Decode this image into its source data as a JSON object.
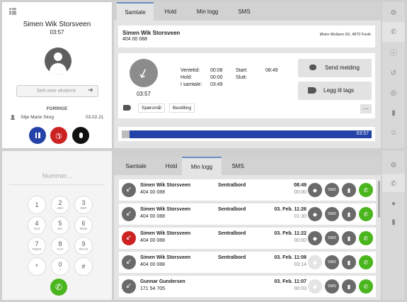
{
  "top": {
    "left": {
      "caller_name": "Simen Wik Storsveen",
      "duration": "03:57",
      "transfer_placeholder": "Sett over eksternt",
      "previous_label": "FORRIGE",
      "previous_contact": "Silje Marie Skog",
      "previous_date": "03.02.21"
    },
    "tabs": [
      "Samtale",
      "Hold",
      "Min logg",
      "SMS"
    ],
    "contact": {
      "name": "Simen Wik Storsveen",
      "phone": "404 00 088",
      "address": "Østre Moåsen 60, 4870 Fevik"
    },
    "call": {
      "duration": "03:57",
      "waiting_label": "Ventetid:",
      "waiting_value": "00:08",
      "hold_label": "Hold:",
      "hold_value": "00:00",
      "in_call_label": "I samtale:",
      "in_call_value": "03:49",
      "start_label": "Start:",
      "start_value": "08:49",
      "end_label": "Slutt:",
      "end_value": ""
    },
    "actions": {
      "send_message": "Send melding",
      "add_tags": "Legg til tags",
      "more": "..."
    },
    "tags": [
      "Spørsmål",
      "Bestilling"
    ],
    "progress": {
      "label": "03:57",
      "fraction": 0.97
    }
  },
  "bottom": {
    "number_placeholder": "Nummer...",
    "keys": [
      {
        "d": "1",
        "l": ""
      },
      {
        "d": "2",
        "l": "ABC"
      },
      {
        "d": "3",
        "l": "DEF"
      },
      {
        "d": "4",
        "l": "GHI"
      },
      {
        "d": "5",
        "l": "JKL"
      },
      {
        "d": "6",
        "l": "MNO"
      },
      {
        "d": "7",
        "l": "PQRS"
      },
      {
        "d": "8",
        "l": "TUV"
      },
      {
        "d": "9",
        "l": "WXYZ"
      },
      {
        "d": "*",
        "l": ""
      },
      {
        "d": "0",
        "l": "+"
      },
      {
        "d": "#",
        "l": ""
      }
    ],
    "tabs": [
      "Samtale",
      "Hold",
      "Min logg",
      "SMS"
    ],
    "log": [
      {
        "name": "Simen Wik Storsveen",
        "phone": "404 00 088",
        "source": "Sentralbord",
        "time": "08:49",
        "duration": "00:00",
        "missed": false,
        "tag_active": true
      },
      {
        "name": "Simen Wik Storsveen",
        "phone": "404 00 088",
        "source": "Sentralbord",
        "time": "03. Feb. 11:26",
        "duration": "01:30",
        "missed": false,
        "tag_active": true
      },
      {
        "name": "Simen Wik Storsveen",
        "phone": "404 00 088",
        "source": "Sentralbord",
        "time": "03. Feb. 11:22",
        "duration": "00:00",
        "missed": true,
        "tag_active": true
      },
      {
        "name": "Simen Wik Storsveen",
        "phone": "404 00 088",
        "source": "Sentralbord",
        "time": "03. Feb. 11:08",
        "duration": "03:14",
        "missed": false,
        "tag_active": false
      },
      {
        "name": "Gunnar Gundersen",
        "phone": "171 54 705",
        "source": "",
        "time": "03. Feb. 11:07",
        "duration": "00:03",
        "missed": false,
        "tag_active": false
      }
    ],
    "sms_label": "SMS"
  },
  "colors": {
    "accent_blue": "#2442a8",
    "green": "#4bb51e",
    "red": "#cc2222",
    "rail": "#e0e0e0"
  }
}
